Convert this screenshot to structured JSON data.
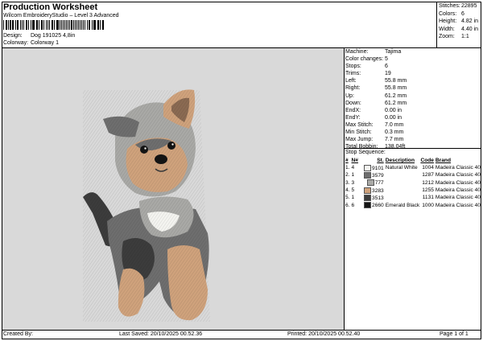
{
  "header": {
    "title": "Production Worksheet",
    "subtitle": "Wilcom EmbroideryStudio – Level 3 Advanced",
    "design_label": "Design:",
    "design_value": "Dog 191025 4,8in",
    "colorway_label": "Colorway:",
    "colorway_value": "Colorway 1"
  },
  "summary": [
    {
      "label": "Stitches:",
      "value": "22895"
    },
    {
      "label": "Colors:",
      "value": "6"
    },
    {
      "label": "Height:",
      "value": "4.82 in"
    },
    {
      "label": "Width:",
      "value": "4.40 in"
    },
    {
      "label": "Zoom:",
      "value": "1:1"
    }
  ],
  "info": [
    {
      "label": "Machine:",
      "value": "Tajima"
    },
    {
      "label": "Color changes:",
      "value": "5"
    },
    {
      "label": "Stops:",
      "value": "6"
    },
    {
      "label": "Trims:",
      "value": "19"
    },
    {
      "label": "Left:",
      "value": "55.8 mm"
    },
    {
      "label": "Right:",
      "value": "55.8 mm"
    },
    {
      "label": "Up:",
      "value": "61.2 mm"
    },
    {
      "label": "Down:",
      "value": "61.2 mm"
    },
    {
      "label": "EndX:",
      "value": "0.00 in"
    },
    {
      "label": "EndY:",
      "value": "0.00 in"
    },
    {
      "label": "Max Stitch:",
      "value": "7.0 mm"
    },
    {
      "label": "Min Stitch:",
      "value": "0.3 mm"
    },
    {
      "label": "Max Jump:",
      "value": "7.7 mm"
    },
    {
      "label": "Total Bobbin:",
      "value": "138.04ft"
    }
  ],
  "sequence": {
    "title": "Stop Sequence:",
    "headers": [
      "#",
      "N#",
      "St.",
      "Description",
      "Code",
      "Brand"
    ],
    "rows": [
      {
        "num": "1.",
        "n": "4",
        "color": "#f4f4f0",
        "st": "9101",
        "desc": "Natural White",
        "code": "1004",
        "brand": "Madeira Classic 40"
      },
      {
        "num": "2.",
        "n": "1",
        "color": "#6e6e6e",
        "st": "3579",
        "desc": "",
        "code": "1287",
        "brand": "Madeira Classic 40"
      },
      {
        "num": "3.",
        "n": "3",
        "color": "#a9a9a6",
        "st": "777",
        "desc": "",
        "code": "1212",
        "brand": "Madeira Classic 40"
      },
      {
        "num": "4.",
        "n": "5",
        "color": "#cfa27c",
        "st": "3283",
        "desc": "",
        "code": "1255",
        "brand": "Madeira Classic 40"
      },
      {
        "num": "5.",
        "n": "1",
        "color": "#3c3c3c",
        "st": "3513",
        "desc": "",
        "code": "1131",
        "brand": "Madeira Classic 40"
      },
      {
        "num": "6.",
        "n": "6",
        "color": "#141414",
        "st": "2660",
        "desc": "Emerald Black",
        "code": "1000",
        "brand": "Madeira Classic 40"
      }
    ]
  },
  "footer": {
    "created_by": "Created By:",
    "last_saved": "Last Saved: 20/10/2025 00.52.36",
    "printed": "Printed: 20/10/2025 00.52.40",
    "page": "Page 1 of 1"
  },
  "colors": {
    "canvas_bg": "#d9d9d9",
    "fur_light": "#cfa27c",
    "fur_gray": "#a9a9a6",
    "fur_dark": "#3c3c3c",
    "fur_white": "#f4f4f0"
  }
}
